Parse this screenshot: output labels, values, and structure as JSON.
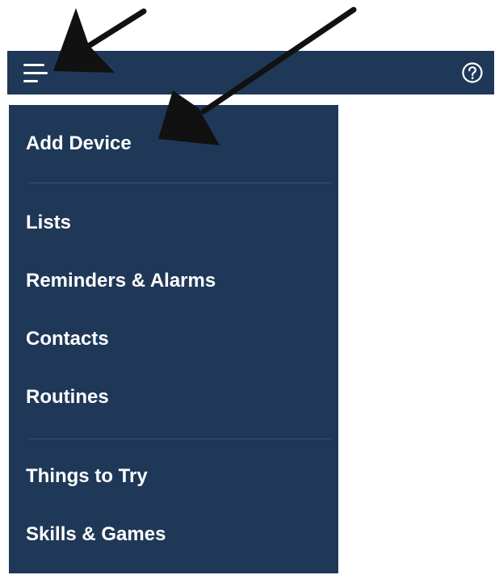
{
  "header": {
    "menu_icon": "hamburger-menu-icon",
    "help_icon": "question-mark-circle-icon"
  },
  "menu": {
    "items": [
      {
        "label": "Add Device"
      },
      {
        "label": "Lists"
      },
      {
        "label": "Reminders & Alarms"
      },
      {
        "label": "Contacts"
      },
      {
        "label": "Routines"
      },
      {
        "label": "Things to Try"
      },
      {
        "label": "Skills & Games"
      }
    ]
  },
  "colors": {
    "nav_background": "#1f3858",
    "menu_text": "#ffffff",
    "divider": "#3a5070",
    "annotation_arrow": "#111111"
  }
}
